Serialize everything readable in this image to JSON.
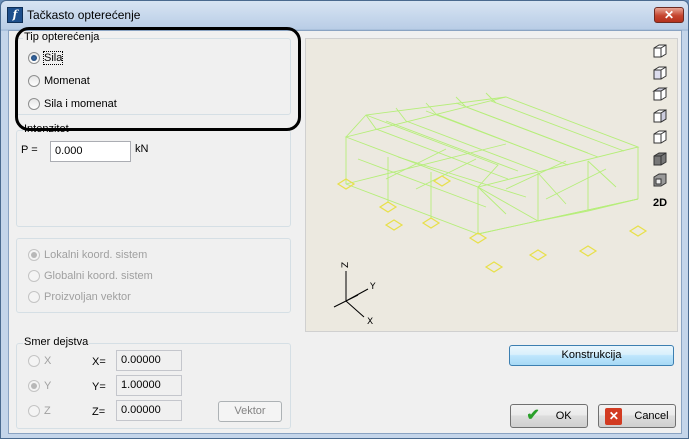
{
  "window": {
    "title": "Tačkasto opterećenje"
  },
  "load_type": {
    "legend": "Tip opterećenja",
    "options": [
      {
        "label": "Sila",
        "checked": true
      },
      {
        "label": "Momenat",
        "checked": false
      },
      {
        "label": "Sila i momenat",
        "checked": false
      }
    ]
  },
  "intensity": {
    "legend": "Intenzitet",
    "p_label": "P =",
    "p_value": "0.000",
    "unit": "kN"
  },
  "coord_system": {
    "options": [
      {
        "label": "Lokalni koord. sistem",
        "checked": true
      },
      {
        "label": "Globalni koord. sistem",
        "checked": false
      },
      {
        "label": "Proizvoljan vektor",
        "checked": false
      }
    ]
  },
  "direction": {
    "legend": "Smer dejstva",
    "rows": [
      {
        "axis": "X",
        "label": "X=",
        "value": "0.00000",
        "checked": false
      },
      {
        "axis": "Y",
        "label": "Y=",
        "value": "1.00000",
        "checked": true
      },
      {
        "axis": "Z",
        "label": "Z=",
        "value": "0.00000",
        "checked": false
      }
    ],
    "vector_button": "Vektor"
  },
  "view": {
    "toolbar": [
      "view-iso-icon",
      "view-front-icon",
      "view-box-icon",
      "view-side-icon",
      "view-back-icon",
      "view-solid-icon",
      "view-3d-icon"
    ],
    "toolbar_2d": "2D",
    "axes": {
      "x": "X",
      "y": "Y",
      "z": "Z"
    }
  },
  "buttons": {
    "construction": "Konstrukcija",
    "ok": "OK",
    "cancel": "Cancel"
  },
  "colors": {
    "frame": "#b6ee7a",
    "support": "#e8e04a",
    "view_bg": "#ece9e0",
    "accent_blue": "#3b7fc6"
  }
}
